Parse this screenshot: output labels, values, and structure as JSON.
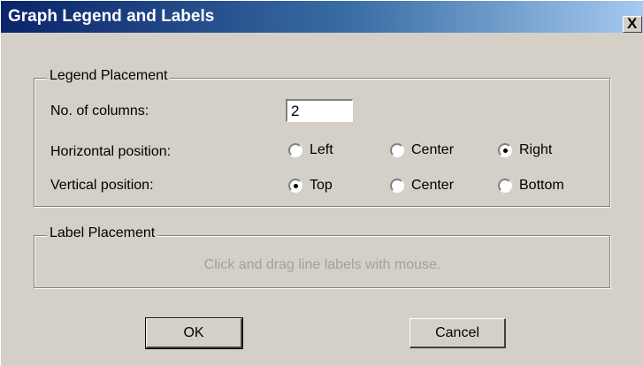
{
  "window": {
    "title": "Graph Legend and Labels",
    "close_label": "X"
  },
  "legend_group": {
    "title": "Legend Placement",
    "columns_label": "No. of columns:",
    "columns_value": "2",
    "horizontal_label": "Horizontal position:",
    "horizontal_options": [
      "Left",
      "Center",
      "Right"
    ],
    "horizontal_selected": "Right",
    "vertical_label": "Vertical position:",
    "vertical_options": [
      "Top",
      "Center",
      "Bottom"
    ],
    "vertical_selected": "Top"
  },
  "label_group": {
    "title": "Label Placement",
    "hint": "Click and drag line labels with mouse."
  },
  "buttons": {
    "ok": "OK",
    "cancel": "Cancel"
  }
}
